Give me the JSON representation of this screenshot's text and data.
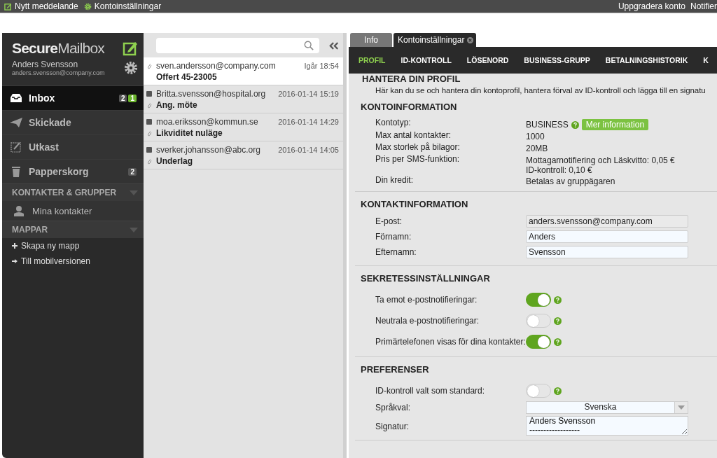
{
  "topbar": {
    "left": [
      {
        "label": "Nytt meddelande",
        "kind": "compose"
      },
      {
        "label": "Kontoinställningar",
        "kind": "settings"
      }
    ],
    "right": [
      "Uppgradera konto",
      "Notifier"
    ]
  },
  "sidebar": {
    "logo": "**Secure**Mailbox",
    "user_name": "Anders Svensson",
    "user_email": "anders.svensson@company.com",
    "folders": [
      {
        "label": "Inbox",
        "kind": "inbox",
        "selected": true,
        "badges": [
          {
            "text": "2",
            "color": "#555555"
          },
          {
            "text": "1",
            "color": "#6cb52d"
          }
        ]
      },
      {
        "label": "Skickade",
        "kind": "sent",
        "selected": false
      },
      {
        "label": "Utkast",
        "kind": "draft",
        "selected": false
      },
      {
        "label": "Papperskorg",
        "kind": "trash",
        "selected": false,
        "badges": [
          {
            "text": "2",
            "color": "#555555"
          }
        ]
      }
    ],
    "sections": [
      {
        "title": "KONTAKTER & GRUPPER",
        "items": [
          {
            "label": "Mina kontakter",
            "kind": "contacts"
          }
        ]
      },
      {
        "title": "MAPPAR",
        "items": [
          {
            "label": "Skapa ny mapp",
            "kind": "add"
          },
          {
            "label": "Till mobilversionen",
            "kind": "arrow"
          }
        ]
      }
    ]
  },
  "messages": [
    {
      "sender": "sven.andersson@company.com",
      "date": "Igår 18:54",
      "subject": "Offert 45-23005",
      "selected": true,
      "unread": false
    },
    {
      "sender": "Britta.svensson@hospital.org",
      "date": "2016-01-14 15:19",
      "subject": "Ang. möte",
      "selected": false,
      "unread": true
    },
    {
      "sender": "moa.eriksson@kommun.se",
      "date": "2016-01-14 14:29",
      "subject": "Likviditet nuläge",
      "selected": false,
      "unread": true
    },
    {
      "sender": "sverker.johansson@abc.org",
      "date": "2016-01-14 14:05",
      "subject": "Underlag",
      "selected": false,
      "unread": true
    }
  ],
  "tabs": [
    {
      "label": "Info",
      "selected": false,
      "closable": false
    },
    {
      "label": "Kontoinställningar",
      "selected": true,
      "closable": true
    }
  ],
  "nav": [
    {
      "label": "PROFIL",
      "selected": true
    },
    {
      "label": "ID-KONTROLL",
      "selected": false
    },
    {
      "label": "LÖSENORD",
      "selected": false
    },
    {
      "label": "BUSINESS-GRUPP",
      "selected": false
    },
    {
      "label": "BETALNINGSHISTORIK",
      "selected": false
    },
    {
      "label": "K",
      "selected": false
    }
  ],
  "profile": {
    "title": "HANTERA DIN PROFIL",
    "intro": "Här kan du se och hantera din kontoprofil, hantera förval av ID-kontroll och lägga till en signatu"
  },
  "sections": [
    {
      "title": "KONTOINFORMATION",
      "rows": [
        {
          "kind": "text",
          "label": "Kontotyp:",
          "value": "BUSINESS",
          "help": true,
          "button": "Mer information"
        },
        {
          "kind": "text",
          "label": "Max antal kontakter:",
          "value": "1000"
        },
        {
          "kind": "text",
          "label": "Max storlek på bilagor:",
          "value": "20MB"
        },
        {
          "kind": "text",
          "label": "Pris per SMS-funktion:",
          "value": "Mottagarnotifiering och Läskvitto: 0,05 €",
          "value2": "ID-kontroll: 0,10 €"
        },
        {
          "kind": "text",
          "label": "Din kredit:",
          "value": "Betalas av gruppägaren"
        }
      ]
    },
    {
      "title": "KONTAKTINFORMATION",
      "rows": [
        {
          "kind": "input",
          "label": "E-post:",
          "value": "anders.svensson@company.com",
          "disabled": true
        },
        {
          "kind": "input",
          "label": "Förnamn:",
          "value": "Anders",
          "disabled": false
        },
        {
          "kind": "input",
          "label": "Efternamn:",
          "value": "Svensson",
          "disabled": false
        }
      ]
    },
    {
      "title": "SEKRETESSINSTÄLLNINGAR",
      "rows": [
        {
          "kind": "toggle",
          "label": "Ta emot e-postnotifieringar:",
          "on": true
        },
        {
          "kind": "toggle",
          "label": "Neutrala e-postnotifieringar:",
          "on": false
        },
        {
          "kind": "toggle",
          "label": "Primärtelefonen visas för dina kontakter:",
          "on": true
        }
      ]
    },
    {
      "title": "PREFERENSER",
      "rows": [
        {
          "kind": "toggle",
          "label": "ID-kontroll valt som standard:",
          "on": false
        },
        {
          "kind": "select",
          "label": "Språkval:",
          "value": "Svenska"
        },
        {
          "kind": "textarea",
          "label": "Signatur:",
          "value": "Anders Svensson\n------------------"
        }
      ]
    }
  ]
}
